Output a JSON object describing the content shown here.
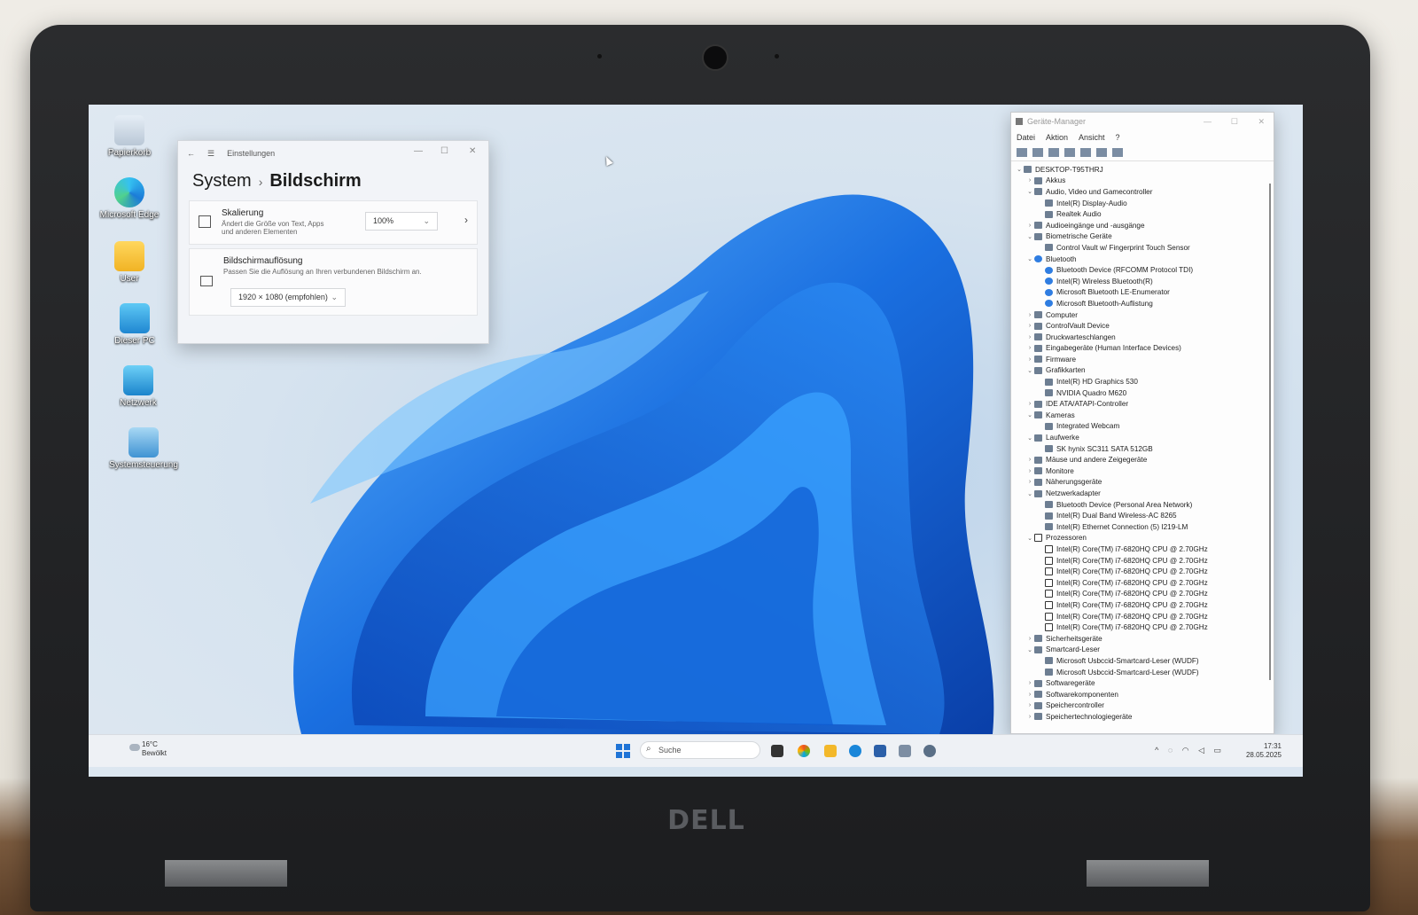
{
  "desktop": {
    "icons": [
      {
        "label": "Papierkorb",
        "icon": "recycle-bin-icon"
      },
      {
        "label": "Microsoft Edge",
        "icon": "edge-icon"
      },
      {
        "label": "User",
        "icon": "folder-icon"
      },
      {
        "label": "Dieser PC",
        "icon": "monitor-icon"
      },
      {
        "label": "Netzwerk",
        "icon": "network-icon"
      },
      {
        "label": "Systemsteuerung",
        "icon": "control-panel-icon"
      }
    ]
  },
  "settings": {
    "app_title": "Einstellungen",
    "breadcrumb_parent": "System",
    "breadcrumb_current": "Bildschirm",
    "scaling": {
      "heading": "Skalierung",
      "desc_line1": "Ändert die Größe von Text, Apps",
      "desc_line2": "und anderen Elementen",
      "value": "100%"
    },
    "resolution": {
      "heading": "Bildschirmauflösung",
      "desc": "Passen Sie die Auflösung an Ihren verbundenen Bildschirm an.",
      "value": "1920 × 1080 (empfohlen)"
    }
  },
  "device_manager": {
    "title": "Geräte-Manager",
    "menu": [
      "Datei",
      "Aktion",
      "Ansicht",
      "?"
    ],
    "tree": [
      {
        "t": "DESKTOP-T95THRJ",
        "l": 0,
        "a": "v",
        "i": "pc"
      },
      {
        "t": "Akkus",
        "l": 1,
        "a": ">",
        "i": "x"
      },
      {
        "t": "Audio, Video und Gamecontroller",
        "l": 1,
        "a": "v",
        "i": "x"
      },
      {
        "t": "Intel(R) Display-Audio",
        "l": 2,
        "a": "",
        "i": "x"
      },
      {
        "t": "Realtek Audio",
        "l": 2,
        "a": "",
        "i": "x"
      },
      {
        "t": "Audioeingänge und -ausgänge",
        "l": 1,
        "a": ">",
        "i": "x"
      },
      {
        "t": "Biometrische Geräte",
        "l": 1,
        "a": "v",
        "i": "x"
      },
      {
        "t": "Control Vault w/ Fingerprint Touch Sensor",
        "l": 2,
        "a": "",
        "i": "x"
      },
      {
        "t": "Bluetooth",
        "l": 1,
        "a": "v",
        "i": "bt"
      },
      {
        "t": "Bluetooth Device (RFCOMM Protocol TDI)",
        "l": 2,
        "a": "",
        "i": "bt"
      },
      {
        "t": "Intel(R) Wireless Bluetooth(R)",
        "l": 2,
        "a": "",
        "i": "bt"
      },
      {
        "t": "Microsoft Bluetooth LE-Enumerator",
        "l": 2,
        "a": "",
        "i": "bt"
      },
      {
        "t": "Microsoft Bluetooth-Auflistung",
        "l": 2,
        "a": "",
        "i": "bt"
      },
      {
        "t": "Computer",
        "l": 1,
        "a": ">",
        "i": "x"
      },
      {
        "t": "ControlVault Device",
        "l": 1,
        "a": ">",
        "i": "x"
      },
      {
        "t": "Druckwarteschlangen",
        "l": 1,
        "a": ">",
        "i": "x"
      },
      {
        "t": "Eingabegeräte (Human Interface Devices)",
        "l": 1,
        "a": ">",
        "i": "x"
      },
      {
        "t": "Firmware",
        "l": 1,
        "a": ">",
        "i": "x"
      },
      {
        "t": "Grafikkarten",
        "l": 1,
        "a": "v",
        "i": "x"
      },
      {
        "t": "Intel(R) HD Graphics 530",
        "l": 2,
        "a": "",
        "i": "x"
      },
      {
        "t": "NVIDIA Quadro M620",
        "l": 2,
        "a": "",
        "i": "x"
      },
      {
        "t": "IDE ATA/ATAPI-Controller",
        "l": 1,
        "a": ">",
        "i": "x"
      },
      {
        "t": "Kameras",
        "l": 1,
        "a": "v",
        "i": "x"
      },
      {
        "t": "Integrated Webcam",
        "l": 2,
        "a": "",
        "i": "x"
      },
      {
        "t": "Laufwerke",
        "l": 1,
        "a": "v",
        "i": "x"
      },
      {
        "t": "SK hynix SC311 SATA 512GB",
        "l": 2,
        "a": "",
        "i": "x"
      },
      {
        "t": "Mäuse und andere Zeigegeräte",
        "l": 1,
        "a": ">",
        "i": "x"
      },
      {
        "t": "Monitore",
        "l": 1,
        "a": ">",
        "i": "x"
      },
      {
        "t": "Näherungsgeräte",
        "l": 1,
        "a": ">",
        "i": "x"
      },
      {
        "t": "Netzwerkadapter",
        "l": 1,
        "a": "v",
        "i": "x"
      },
      {
        "t": "Bluetooth Device (Personal Area Network)",
        "l": 2,
        "a": "",
        "i": "x"
      },
      {
        "t": "Intel(R) Dual Band Wireless-AC 8265",
        "l": 2,
        "a": "",
        "i": "x"
      },
      {
        "t": "Intel(R) Ethernet Connection (5) I219-LM",
        "l": 2,
        "a": "",
        "i": "x"
      },
      {
        "t": "Prozessoren",
        "l": 1,
        "a": "v",
        "i": "cpu"
      },
      {
        "t": "Intel(R) Core(TM) i7-6820HQ CPU @ 2.70GHz",
        "l": 2,
        "a": "",
        "i": "cpu"
      },
      {
        "t": "Intel(R) Core(TM) i7-6820HQ CPU @ 2.70GHz",
        "l": 2,
        "a": "",
        "i": "cpu"
      },
      {
        "t": "Intel(R) Core(TM) i7-6820HQ CPU @ 2.70GHz",
        "l": 2,
        "a": "",
        "i": "cpu"
      },
      {
        "t": "Intel(R) Core(TM) i7-6820HQ CPU @ 2.70GHz",
        "l": 2,
        "a": "",
        "i": "cpu"
      },
      {
        "t": "Intel(R) Core(TM) i7-6820HQ CPU @ 2.70GHz",
        "l": 2,
        "a": "",
        "i": "cpu"
      },
      {
        "t": "Intel(R) Core(TM) i7-6820HQ CPU @ 2.70GHz",
        "l": 2,
        "a": "",
        "i": "cpu"
      },
      {
        "t": "Intel(R) Core(TM) i7-6820HQ CPU @ 2.70GHz",
        "l": 2,
        "a": "",
        "i": "cpu"
      },
      {
        "t": "Intel(R) Core(TM) i7-6820HQ CPU @ 2.70GHz",
        "l": 2,
        "a": "",
        "i": "cpu"
      },
      {
        "t": "Sicherheitsgeräte",
        "l": 1,
        "a": ">",
        "i": "x"
      },
      {
        "t": "Smartcard-Leser",
        "l": 1,
        "a": "v",
        "i": "x"
      },
      {
        "t": "Microsoft Usbccid-Smartcard-Leser (WUDF)",
        "l": 2,
        "a": "",
        "i": "x"
      },
      {
        "t": "Microsoft Usbccid-Smartcard-Leser (WUDF)",
        "l": 2,
        "a": "",
        "i": "x"
      },
      {
        "t": "Softwaregeräte",
        "l": 1,
        "a": ">",
        "i": "x"
      },
      {
        "t": "Softwarekomponenten",
        "l": 1,
        "a": ">",
        "i": "x"
      },
      {
        "t": "Speichercontroller",
        "l": 1,
        "a": ">",
        "i": "x"
      },
      {
        "t": "Speichertechnologiegeräte",
        "l": 1,
        "a": ">",
        "i": "x"
      }
    ]
  },
  "taskbar": {
    "weather_temp": "16°C",
    "weather_desc": "Bewölkt",
    "search_placeholder": "Suche",
    "time": "17:31",
    "date": "28.05.2025"
  },
  "brand": "DELL",
  "colors": {
    "accent": "#1f74d6",
    "bloom": "#1a6fe0"
  }
}
